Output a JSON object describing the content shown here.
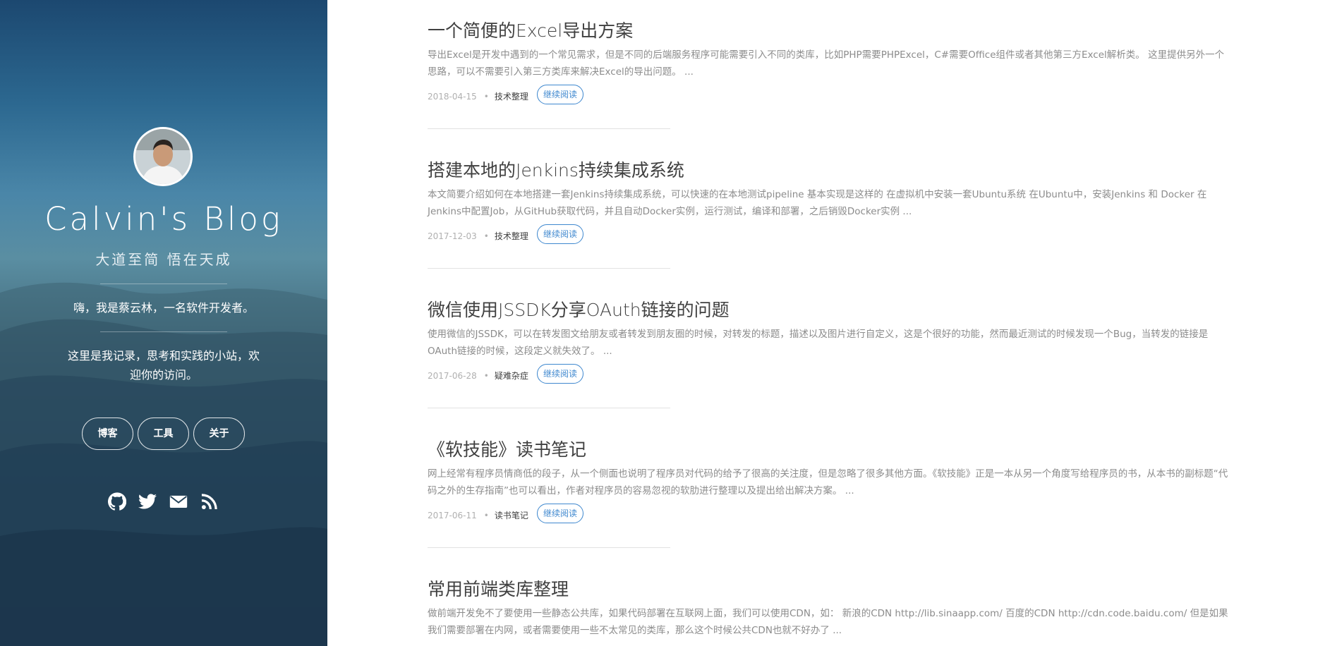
{
  "sidebar": {
    "site_title": "Calvin's Blog",
    "subtitle": "大道至简 悟在天成",
    "intro_1": "嗨，我是蔡云林，一名软件开发者。",
    "intro_2": "这里是我记录，思考和实践的小站，欢迎你的访问。",
    "nav": [
      {
        "label": "博客"
      },
      {
        "label": "工具"
      },
      {
        "label": "关于"
      }
    ],
    "social_icons": [
      "github-icon",
      "twitter-icon",
      "email-icon",
      "rss-icon"
    ]
  },
  "posts": [
    {
      "title": "一个简便的Excel导出方案",
      "excerpt": "导出Excel是开发中遇到的一个常见需求，但是不同的后端服务程序可能需要引入不同的类库，比如PHP需要PHPExcel，C#需要Office组件或者其他第三方Excel解析类。 这里提供另外一个思路，可以不需要引入第三方类库来解决Excel的导出问题。 ...",
      "date": "2018-04-15",
      "category": "技术整理",
      "read_more": "继续阅读"
    },
    {
      "title": "搭建本地的Jenkins持续集成系统",
      "excerpt": "本文简要介绍如何在本地搭建一套Jenkins持续集成系统，可以快速的在本地测试pipeline 基本实现是这样的 在虚拟机中安装一套Ubuntu系统 在Ubuntu中，安装Jenkins 和 Docker 在Jenkins中配置Job，从GitHub获取代码，并且自动Docker实例，运行测试，编译和部署，之后销毁Docker实例 ...",
      "date": "2017-12-03",
      "category": "技术整理",
      "read_more": "继续阅读"
    },
    {
      "title": "微信使用JSSDK分享OAuth链接的问题",
      "excerpt": "使用微信的JSSDK，可以在转发图文给朋友或者转发到朋友圈的时候，对转发的标题，描述以及图片进行自定义，这是个很好的功能，然而最近测试的时候发现一个Bug，当转发的链接是OAuth链接的时候，这段定义就失效了。 ...",
      "date": "2017-06-28",
      "category": "疑难杂症",
      "read_more": "继续阅读"
    },
    {
      "title": "《软技能》读书笔记",
      "excerpt": "网上经常有程序员情商低的段子，从一个侧面也说明了程序员对代码的给予了很高的关注度，但是忽略了很多其他方面。《软技能》正是一本从另一个角度写给程序员的书，从本书的副标题“代码之外的生存指南”也可以看出，作者对程序员的容易忽视的软肋进行整理以及提出给出解决方案。 ...",
      "date": "2017-06-11",
      "category": "读书笔记",
      "read_more": "继续阅读"
    },
    {
      "title": "常用前端类库整理",
      "excerpt": "做前端开发免不了要使用一些静态公共库，如果代码部署在互联网上面，我们可以使用CDN，如： 新浪的CDN http://lib.sinaapp.com/ 百度的CDN http://cdn.code.baidu.com/ 但是如果我们需要部署在内网，或者需要使用一些不太常见的类库，那么这个时候公共CDN也就不好办了 ...",
      "date": "",
      "category": "",
      "read_more": ""
    }
  ],
  "colors": {
    "accent": "#3f88cf",
    "title": "#404040",
    "excerpt": "#8c8c8c",
    "meta": "#b0b0b0"
  }
}
